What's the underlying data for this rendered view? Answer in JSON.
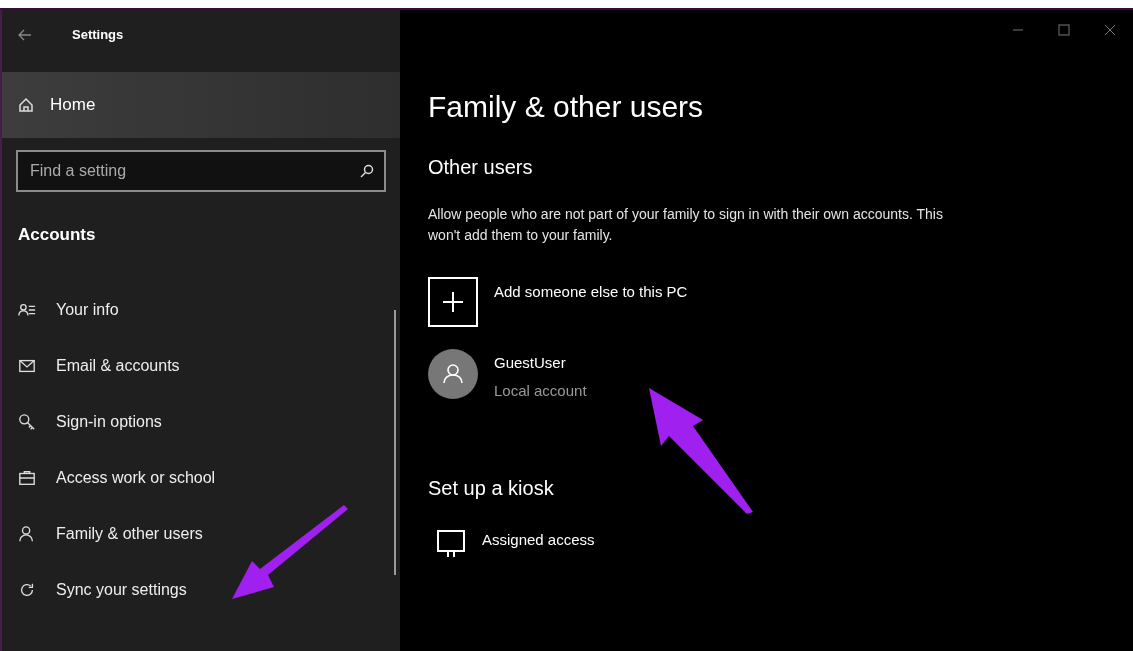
{
  "window": {
    "title": "Settings"
  },
  "sidebar": {
    "home": "Home",
    "search": {
      "placeholder": "Find a setting"
    },
    "section": "Accounts",
    "items": [
      {
        "label": "Your info"
      },
      {
        "label": "Email & accounts"
      },
      {
        "label": "Sign-in options"
      },
      {
        "label": "Access work or school"
      },
      {
        "label": "Family & other users"
      },
      {
        "label": "Sync your settings"
      }
    ]
  },
  "page": {
    "title": "Family & other users",
    "section": "Other users",
    "description": "Allow people who are not part of your family to sign in with their own accounts. This won't add them to your family.",
    "add_button": "Add someone else to this PC",
    "users": [
      {
        "name": "GuestUser",
        "type": "Local account"
      }
    ],
    "kiosk": {
      "title": "Set up a kiosk",
      "item": "Assigned access"
    }
  }
}
